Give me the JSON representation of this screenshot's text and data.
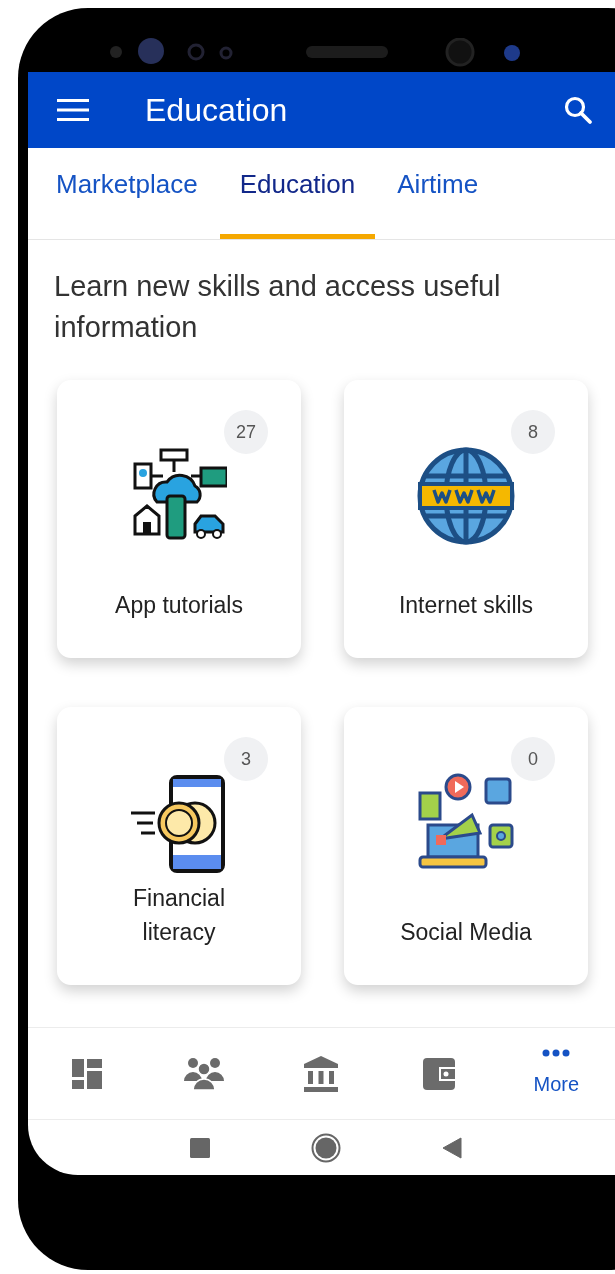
{
  "app_bar": {
    "title": "Education"
  },
  "tabs": [
    {
      "label": "Marketplace",
      "selected": false
    },
    {
      "label": "Education",
      "selected": true
    },
    {
      "label": "Airtime",
      "selected": false
    }
  ],
  "description": "Learn new skills and access useful information",
  "categories": [
    {
      "title": "App tutorials",
      "count": "27",
      "kind": "network"
    },
    {
      "title": "Internet skills",
      "count": "8",
      "kind": "globe"
    },
    {
      "title": "Financial literacy",
      "count": "3",
      "kind": "payment"
    },
    {
      "title": "Social Media",
      "count": "0",
      "kind": "social"
    }
  ],
  "bottom_nav": [
    {
      "kind": "dashboard",
      "selected": false
    },
    {
      "kind": "groups",
      "selected": false
    },
    {
      "kind": "bank",
      "selected": false
    },
    {
      "kind": "wallet",
      "selected": false
    },
    {
      "kind": "more",
      "label": "More",
      "selected": true
    }
  ]
}
